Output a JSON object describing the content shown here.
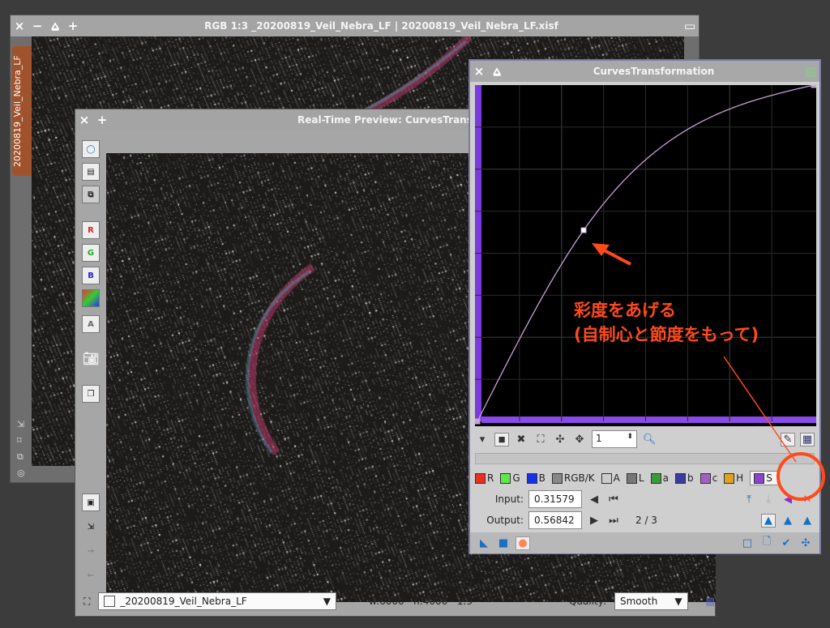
{
  "back_window": {
    "title": "RGB 1:3 _20200819_Veil_Nebra_LF | 20200819_Veil_Nebra_LF.xisf",
    "side_tab": "20200819_Veil_Nebra_LF"
  },
  "preview_window": {
    "title": "Real-Time Preview: CurvesTransformation",
    "tools": [
      "R",
      "G",
      "B",
      "A"
    ],
    "view_select": "_20200819_Veil_Nebra_LF",
    "info": "w:6000 · h:4000 · 1:9",
    "quality_label": "Quality:",
    "quality_value": "Smooth"
  },
  "curves": {
    "title": "CurvesTransformation",
    "zoom_value": "1",
    "channels": [
      {
        "label": "R",
        "color": "#e8301e"
      },
      {
        "label": "G",
        "color": "#5fe84a"
      },
      {
        "label": "B",
        "color": "#1432e8"
      },
      {
        "label": "RGB/K",
        "color": "#888"
      },
      {
        "label": "A",
        "color": "#ccc"
      },
      {
        "label": "L",
        "color": "#777"
      },
      {
        "label": "a",
        "color": "#3a9a3a"
      },
      {
        "label": "b",
        "color": "#3a3aa0"
      },
      {
        "label": "c",
        "color": "#a060c0"
      },
      {
        "label": "H",
        "color": "#e0a020"
      },
      {
        "label": "S",
        "color": "#8844cc"
      }
    ],
    "selected_channel": "S",
    "input_label": "Input:",
    "input_value": "0.31579",
    "output_label": "Output:",
    "output_value": "0.56842",
    "point_index": "2 / 3",
    "curve_points": [
      [
        0,
        0
      ],
      [
        0.31579,
        0.56842
      ],
      [
        1,
        1
      ]
    ]
  },
  "annotation": {
    "line1": "彩度をあげる",
    "line2": "(自制心と節度をもって)",
    "color": "#ff4a1a"
  }
}
